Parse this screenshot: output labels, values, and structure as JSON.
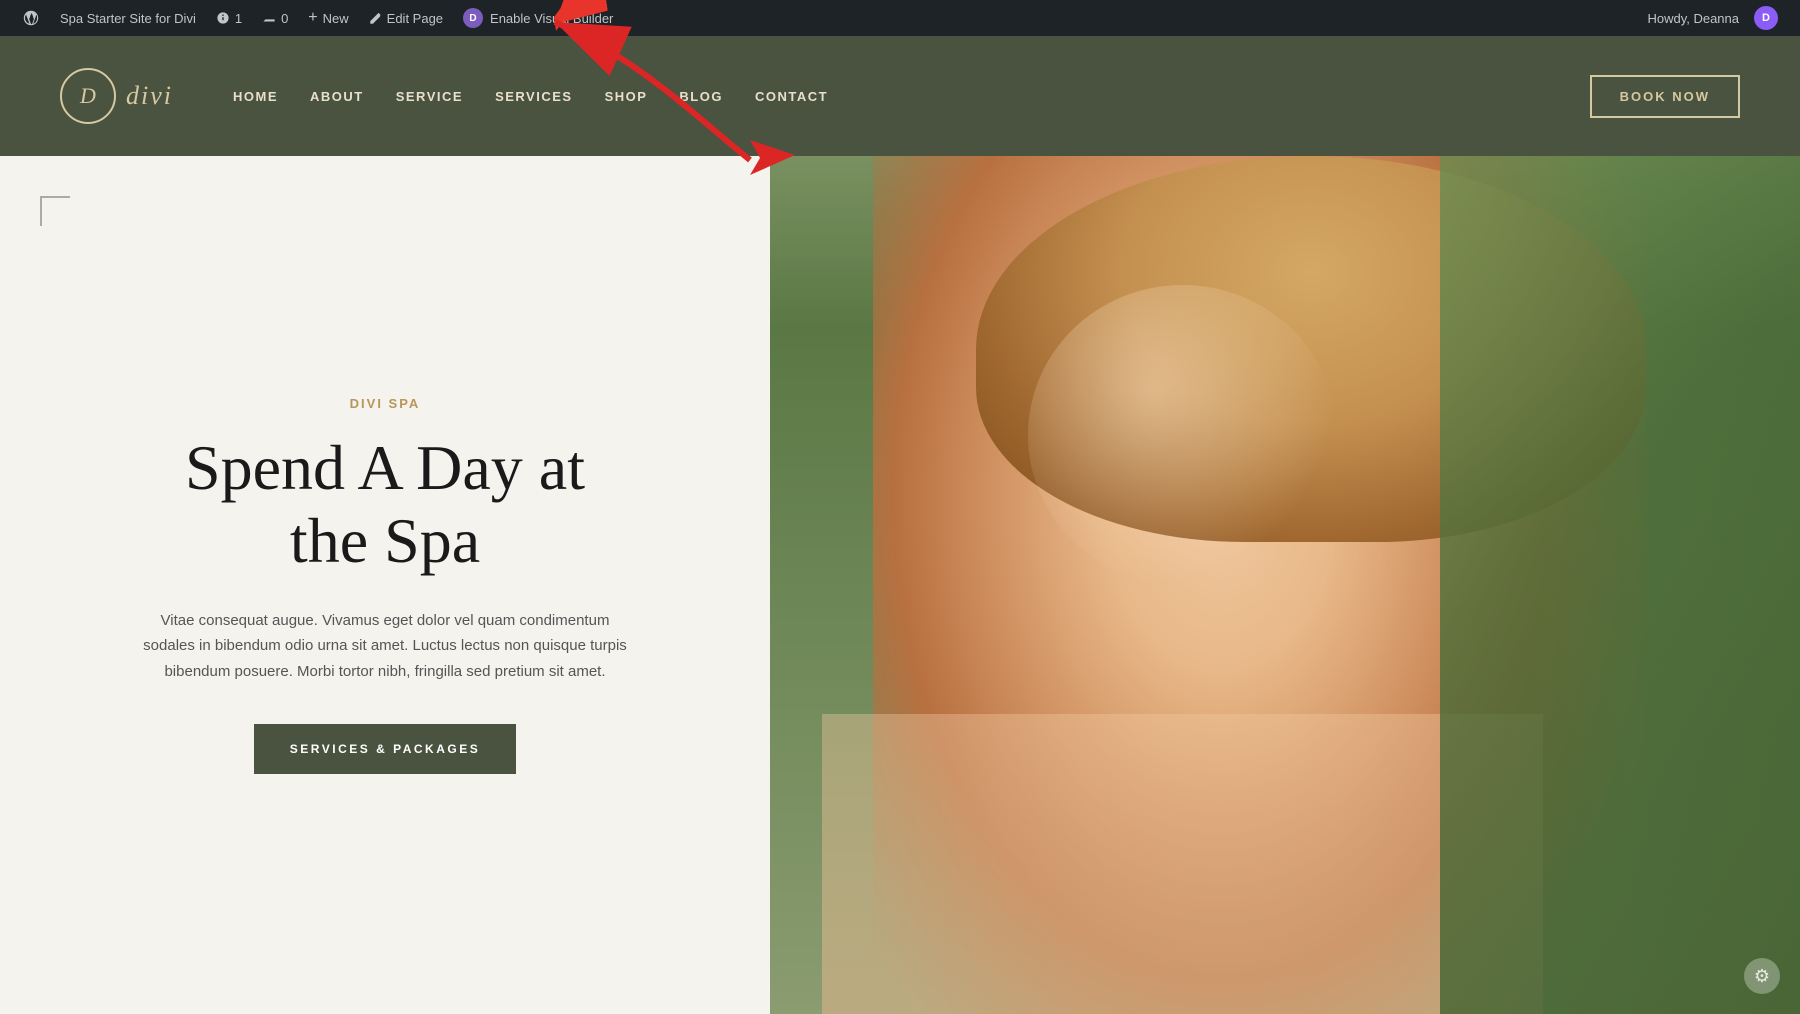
{
  "admin_bar": {
    "site_name": "Spa Starter Site for Divi",
    "revision_label": "1",
    "comments_label": "0",
    "new_label": "New",
    "edit_label": "Edit Page",
    "enable_vb_label": "Enable Visual Builder",
    "howdy_text": "Howdy, Deanna",
    "wp_icon": "W"
  },
  "header": {
    "logo_letter": "D",
    "logo_text": "divi",
    "nav_items": [
      {
        "label": "HOME"
      },
      {
        "label": "ABOUT"
      },
      {
        "label": "SERVICE"
      },
      {
        "label": "SERVICES"
      },
      {
        "label": "SHOP"
      },
      {
        "label": "BLOG"
      },
      {
        "label": "CONTACT"
      }
    ],
    "book_now_label": "BOOK NOW"
  },
  "hero": {
    "subtitle": "DIVI SPA",
    "heading_line1": "Spend A Day at",
    "heading_line2": "the Spa",
    "description": "Vitae consequat augue. Vivamus eget dolor vel quam condimentum sodales in bibendum odio urna sit amet. Luctus lectus non quisque turpis bibendum posuere. Morbi tortor nibh, fringilla sed pretium sit amet.",
    "cta_label": "SERVICES & PACKAGES"
  },
  "colors": {
    "admin_bar_bg": "#1d2327",
    "header_bg": "#4a5240",
    "accent_gold": "#b8965a",
    "cta_bg": "#4a5240",
    "logo_color": "#d4c9a0"
  }
}
